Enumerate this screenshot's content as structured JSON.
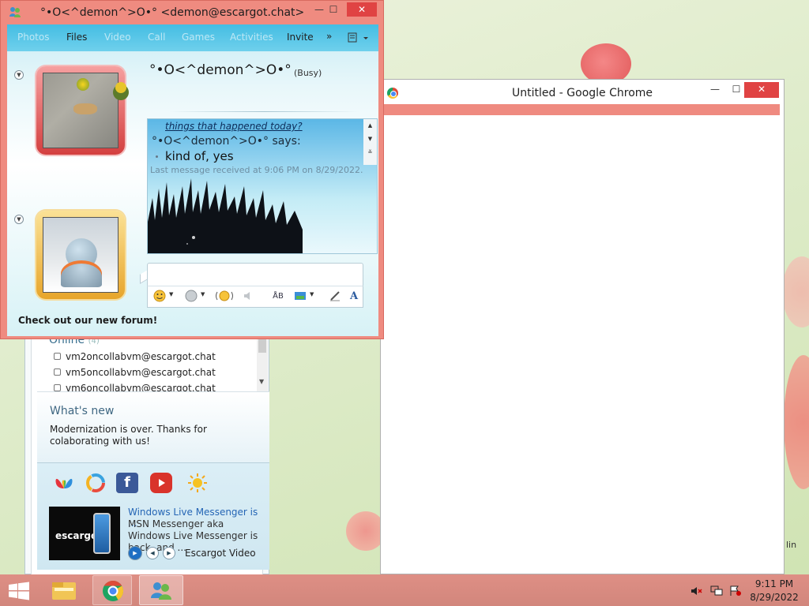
{
  "desktop": {
    "partial_text": "lin"
  },
  "messenger_list": {
    "online_header": "Online",
    "online_count": "(4)",
    "contacts": [
      "vm2oncollabvm@escargot.chat",
      "vm5oncollabvm@escargot.chat",
      "vm6oncollabvm@escargot.chat"
    ],
    "whats_new_title": "What's new",
    "whats_new_text": "Modernization is over. Thanks for colaborating with us!",
    "video": {
      "thumb_label": "escargot",
      "title": "Windows Live Messenger is ...",
      "description": "MSN Messenger aka Windows Live Messenger is back, and ...",
      "source": "Escargot Video"
    },
    "apps": [
      "wlm-butterfly-icon",
      "escargot-icon",
      "facebook-icon",
      "youtube-icon",
      "weather-sun-icon"
    ],
    "facebook_glyph": "f"
  },
  "chrome": {
    "title": "Untitled - Google Chrome",
    "min_glyph": "—",
    "max_glyph": "☐",
    "close_glyph": "✕",
    "accent": "#ef8a80"
  },
  "conversation": {
    "title": "°•O<^demon^>O•° <demon@escargot.chat>",
    "min_glyph": "—",
    "max_glyph": "☐",
    "close_glyph": "✕",
    "menu": [
      "Photos",
      "Files",
      "Video",
      "Call",
      "Games",
      "Activities",
      "Invite"
    ],
    "menu_active": [
      "Files",
      "Invite"
    ],
    "menu_more": "»",
    "contact_name": "°•O<^demon^>O•°",
    "contact_status": "(Busy)",
    "chat": {
      "subject": "things that happened today?",
      "from": "°•O<^demon^>O•° says:",
      "message": "kind of, yes",
      "meta": "Last message received at 9:06 PM on 8/29/2022."
    },
    "forum_link": "Check out our new forum!",
    "window_color": "#ef8b80"
  },
  "taskbar": {
    "time": "9:11 PM",
    "date": "8/29/2022",
    "tray_icons": [
      "volume-muted-icon",
      "network-icon",
      "action-center-flag-icon"
    ]
  }
}
